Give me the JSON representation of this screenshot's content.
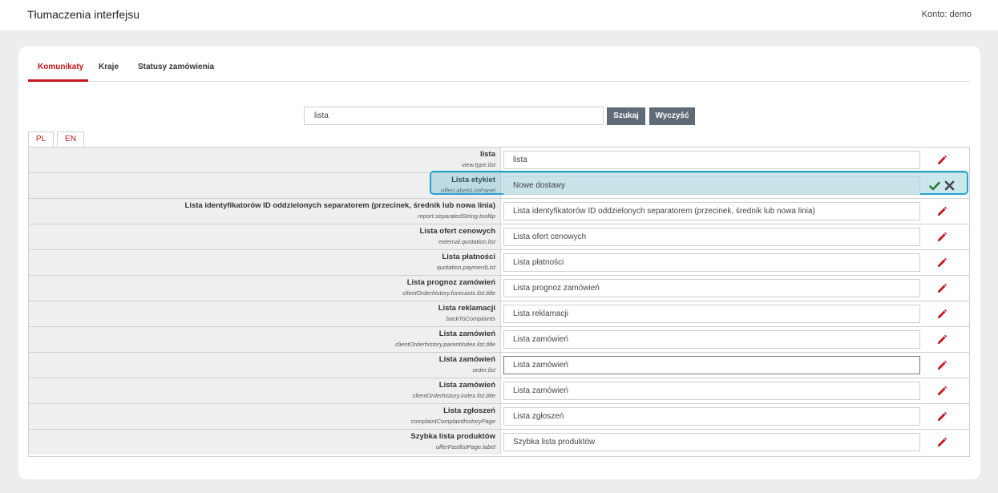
{
  "header": {
    "title": "Tłumaczenia interfejsu",
    "account": "Konto: demo"
  },
  "tabs": [
    {
      "label": "Komunikaty",
      "active": true
    },
    {
      "label": "Kraje",
      "active": false
    },
    {
      "label": "Statusy zamówienia",
      "active": false
    }
  ],
  "search": {
    "value": "lista",
    "search_label": "Szukaj",
    "clear_label": "Wyczyść"
  },
  "languages": [
    "PL",
    "EN"
  ],
  "active_language": "PL",
  "colors": {
    "accent": "#c4161c",
    "button": "#5f6b76",
    "highlight": "#27a3d3",
    "confirm": "#2e7d32"
  },
  "rows": [
    {
      "label": "lista",
      "key": "view.type.list",
      "value": "lista"
    },
    {
      "label": "Lista etykiet",
      "key": "offerLabelsListPanel",
      "value": "Nowe dostawy",
      "editing": true
    },
    {
      "label": "Lista identyfikatorów ID oddzielonych separatorem (przecinek, średnik lub nowa linia)",
      "key": "report.separatedString.tooltip",
      "value": "Lista identyfikatorów ID oddzielonych separatorem (przecinek, średnik lub nowa linia)"
    },
    {
      "label": "Lista ofert cenowych",
      "key": "external.quotation.list",
      "value": "Lista ofert cenowych"
    },
    {
      "label": "Lista płatności",
      "key": "quotation.paymentList",
      "value": "Lista płatności"
    },
    {
      "label": "Lista prognoz zamówień",
      "key": "clientOrderhistory.forecasts.list.title",
      "value": "Lista prognoz zamówień"
    },
    {
      "label": "Lista reklamacji",
      "key": "backToComplaints",
      "value": "Lista reklamacji"
    },
    {
      "label": "Lista zamówień",
      "key": "clientOrderhistory.parentIndex.list.title",
      "value": "Lista zamówień"
    },
    {
      "label": "Lista zamówień",
      "key": "order.list",
      "value": "Lista zamówień",
      "focused": true
    },
    {
      "label": "Lista zamówień",
      "key": "clientOrderhistory.index.list.title",
      "value": "Lista zamówień"
    },
    {
      "label": "Lista zgłoszeń",
      "key": "complaintComplainthistoryPage",
      "value": "Lista zgłoszeń"
    },
    {
      "label": "Szybka lista produktów",
      "key": "offerFastlistPage.label",
      "value": "Szybka lista produktów"
    }
  ]
}
